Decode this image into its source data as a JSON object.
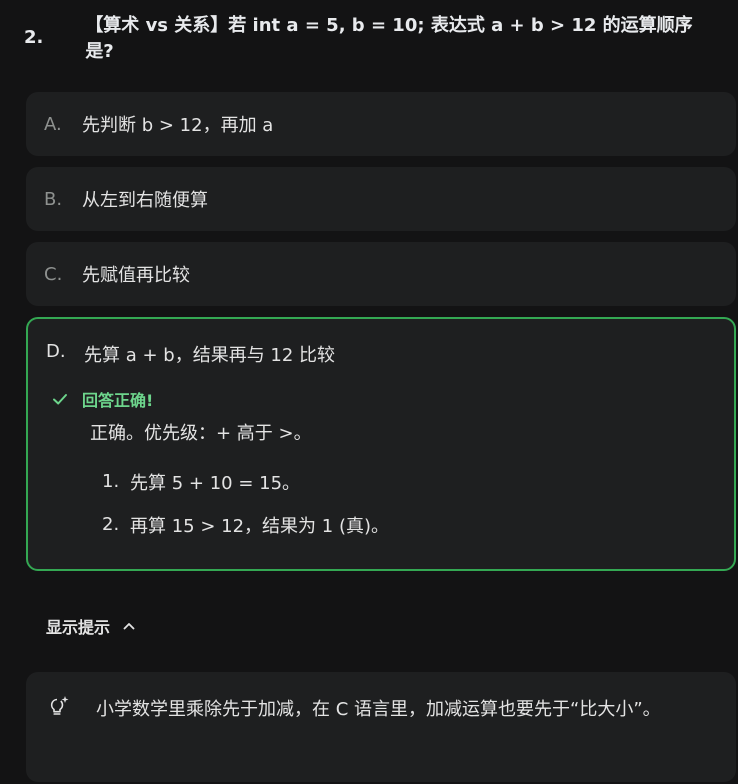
{
  "question": {
    "number": "2.",
    "text": "【算术 vs 关系】若 int a = 5, b = 10; 表达式 a + b > 12 的运算顺序是?"
  },
  "options": [
    {
      "letter": "A.",
      "text": "先判断 b > 12，再加 a"
    },
    {
      "letter": "B.",
      "text": "从左到右随便算"
    },
    {
      "letter": "C.",
      "text": "先赋值再比较"
    },
    {
      "letter": "D.",
      "text": "先算 a + b，结果再与 12 比较"
    }
  ],
  "feedback": {
    "status": "回答正确!",
    "explanation": "正确。优先级：+ 高于 >。",
    "steps": [
      {
        "num": "1.",
        "text": "先算 5 + 10 = 15。"
      },
      {
        "num": "2.",
        "text": "再算 15 > 12，结果为 1 (真)。"
      }
    ]
  },
  "hint": {
    "toggle_label": "显示提示",
    "text": "小学数学里乘除先于加减，在 C 语言里，加减运算也要先于“比大小”。"
  },
  "colors": {
    "background": "#131314",
    "card": "#1e1f20",
    "correct_border": "#34a853",
    "correct_text": "#6dd58c"
  },
  "icons": {
    "correct": "check-icon",
    "toggle": "chevron-up-icon",
    "hint": "lightbulb-sparkle-icon"
  }
}
